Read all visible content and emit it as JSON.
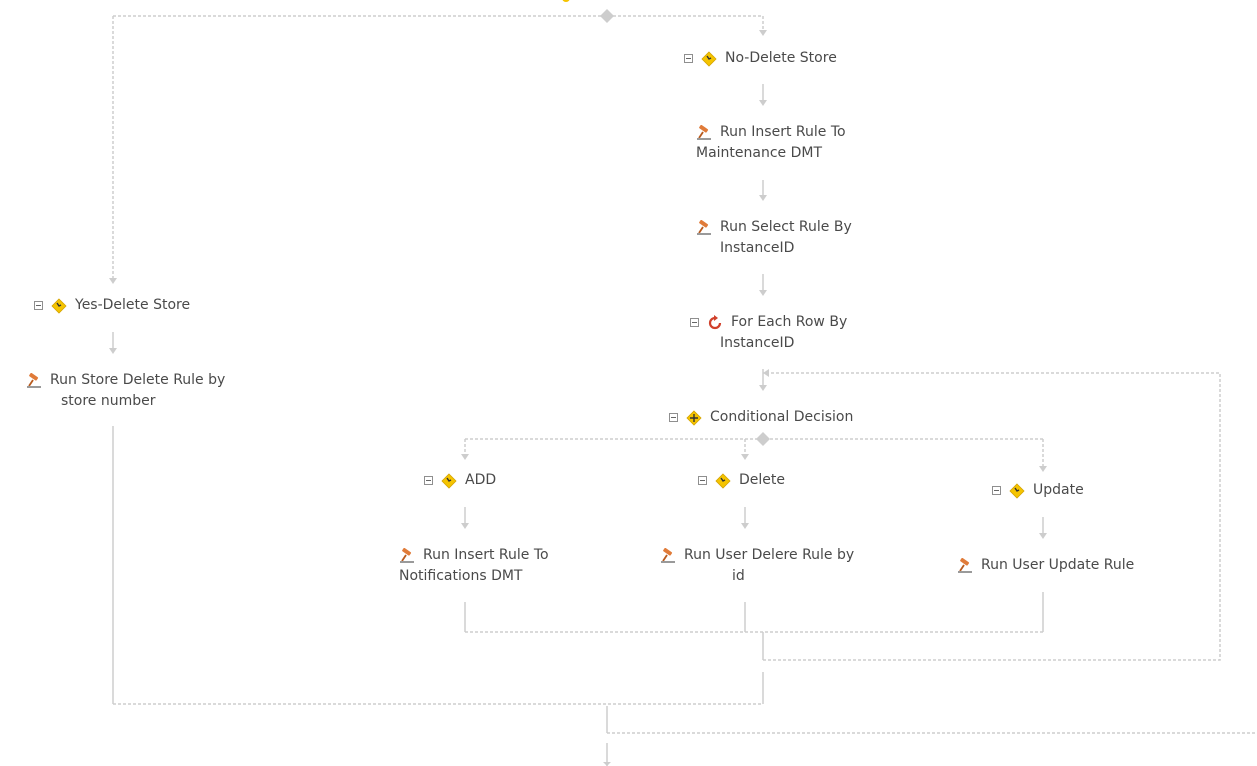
{
  "colors": {
    "connector": "#cdcdcd",
    "text": "#4a4a4a",
    "decision_icon": "#f5c400",
    "rule_icon": "#e07b39",
    "loop_icon": "#d0402b"
  },
  "icons": {
    "decision": "decision-diamond-icon",
    "rule": "gavel-icon",
    "loop": "loop-icon",
    "collapse": "collapse-minus-icon"
  },
  "nodes": {
    "no_delete_store": "No-Delete Store",
    "run_insert_maintenance": {
      "line1": "Run Insert Rule To",
      "line2": "Maintenance DMT"
    },
    "run_select_instanceid": {
      "line1": "Run Select Rule By",
      "line2": "InstanceID"
    },
    "for_each_row": {
      "line1": "For Each Row By",
      "line2": "InstanceID"
    },
    "conditional_decision": "Conditional Decision",
    "yes_delete_store": "Yes-Delete Store",
    "run_store_delete": {
      "line1": "Run Store Delete Rule by",
      "line2": "store number"
    },
    "add": "ADD",
    "delete": "Delete",
    "update": "Update",
    "run_insert_notifications": {
      "line1": "Run Insert Rule To",
      "line2": "Notifications DMT"
    },
    "run_user_delete": {
      "line1": "Run User Delere Rule by",
      "line2": "id"
    },
    "run_user_update": "Run User Update Rule"
  }
}
